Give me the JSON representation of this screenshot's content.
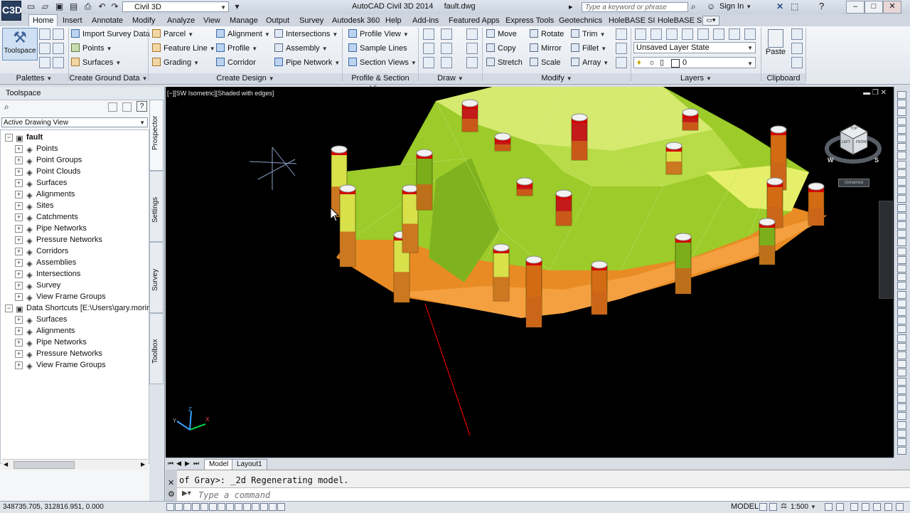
{
  "app": {
    "logo": "C3D",
    "title": "AutoCAD Civil 3D 2014",
    "file": "fault.dwg",
    "workspace": "Civil 3D",
    "search_placeholder": "Type a keyword or phrase",
    "sign_in": "Sign In"
  },
  "tabs": [
    "Home",
    "Insert",
    "Annotate",
    "Modify",
    "Analyze",
    "View",
    "Manage",
    "Output",
    "Survey",
    "Autodesk 360",
    "Help",
    "Add-ins",
    "Featured Apps",
    "Express Tools",
    "Geotechnics",
    "HoleBASE SI",
    "HoleBASE SI"
  ],
  "ribbon": {
    "toolspace": "Toolspace",
    "import_survey": "Import Survey Data",
    "points": "Points",
    "surfaces": "Surfaces",
    "parcel": "Parcel",
    "feature_line": "Feature Line",
    "grading": "Grading",
    "alignment": "Alignment",
    "profile": "Profile",
    "corridor": "Corridor",
    "intersections": "Intersections",
    "assembly": "Assembly",
    "pipe_network": "Pipe Network",
    "profile_view": "Profile View",
    "sample_lines": "Sample Lines",
    "section_views": "Section Views",
    "move": "Move",
    "rotate": "Rotate",
    "trim": "Trim",
    "copy": "Copy",
    "mirror": "Mirror",
    "fillet": "Fillet",
    "stretch": "Stretch",
    "scale": "Scale",
    "array": "Array",
    "layer_state": "Unsaved Layer State",
    "layer_name": "0",
    "paste": "Paste",
    "panels": [
      "Palettes",
      "Create Ground Data",
      "Create Design",
      "Profile & Section Views",
      "Draw",
      "Modify",
      "Layers",
      "Clipboard"
    ]
  },
  "toolspace": {
    "title": "Toolspace",
    "view": "Active Drawing View",
    "tree": [
      {
        "label": "fault",
        "level": 0,
        "bold": true
      },
      {
        "label": "Points",
        "level": 1
      },
      {
        "label": "Point Groups",
        "level": 1
      },
      {
        "label": "Point Clouds",
        "level": 1
      },
      {
        "label": "Surfaces",
        "level": 1
      },
      {
        "label": "Alignments",
        "level": 1
      },
      {
        "label": "Sites",
        "level": 1
      },
      {
        "label": "Catchments",
        "level": 1
      },
      {
        "label": "Pipe Networks",
        "level": 1
      },
      {
        "label": "Pressure Networks",
        "level": 1
      },
      {
        "label": "Corridors",
        "level": 1
      },
      {
        "label": "Assemblies",
        "level": 1
      },
      {
        "label": "Intersections",
        "level": 1
      },
      {
        "label": "Survey",
        "level": 1
      },
      {
        "label": "View Frame Groups",
        "level": 1
      },
      {
        "label": "Data Shortcuts [E:\\Users\\gary.morin\\D...",
        "level": 0
      },
      {
        "label": "Surfaces",
        "level": 1
      },
      {
        "label": "Alignments",
        "level": 1
      },
      {
        "label": "Pipe Networks",
        "level": 1
      },
      {
        "label": "Pressure Networks",
        "level": 1
      },
      {
        "label": "View Frame Groups",
        "level": 1
      }
    ],
    "side_tabs": [
      "Prospector",
      "Settings",
      "Survey",
      "Toolbox"
    ]
  },
  "viewport": {
    "label": "[−][SW Isometric][Shaded with edges]",
    "viewcube_top": "TOP",
    "viewcube_left": "LEFT",
    "viewcube_front": "FRONT",
    "compass_w": "W",
    "compass_s": "S",
    "wcs": "Unnamed"
  },
  "layout_tabs": [
    "Model",
    "Layout1"
  ],
  "command": {
    "history": "of Gray>: _2d Regenerating model.",
    "placeholder": "Type a command"
  },
  "status": {
    "coords": "348735.705, 312816.951, 0.000",
    "model": "MODEL",
    "scale": "1:500"
  }
}
